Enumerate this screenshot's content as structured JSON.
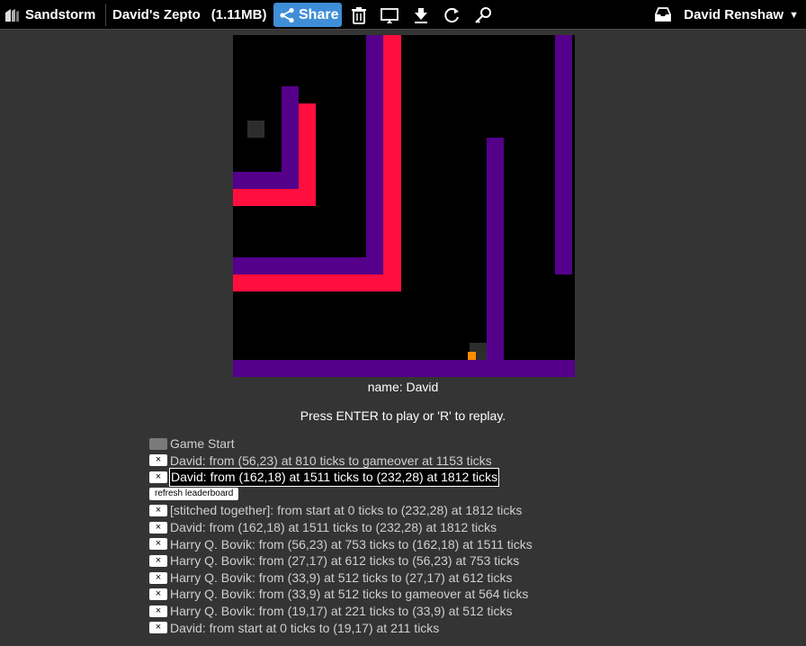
{
  "topbar": {
    "brand": "Sandstorm",
    "grain_title": "David's Zepto",
    "grain_size": "(1.11MB)",
    "share_label": "Share",
    "user_name": "David Renshaw",
    "icons": [
      "trash-icon",
      "monitor-icon",
      "download-icon",
      "restart-icon",
      "key-icon",
      "inbox-icon"
    ]
  },
  "colors": {
    "accent": "#3f8ed8",
    "player_purple": "#55008a",
    "player_red": "#ff0e3e",
    "food": "#ff8c00",
    "background": "#343434"
  },
  "game": {
    "name_label": "name: David",
    "prompt": "Press ENTER to play or 'R' to replay."
  },
  "log": {
    "game_start": "Game Start",
    "entry_1": "David: from (56,23) at 810 ticks to gameover at 1153 ticks",
    "entry_2": "David: from (162,18) at 1511 ticks to (232,28) at 1812 ticks",
    "refresh_label": "refresh leaderboard",
    "leaderboard": [
      "[stitched together]: from start at 0 ticks to (232,28) at 1812 ticks",
      "David: from (162,18) at 1511 ticks to (232,28) at 1812 ticks",
      "Harry Q. Bovik: from (56,23) at 753 ticks to (162,18) at 1511 ticks",
      "Harry Q. Bovik: from (27,17) at 612 ticks to (56,23) at 753 ticks",
      "Harry Q. Bovik: from (33,9) at 512 ticks to (27,17) at 612 ticks",
      "Harry Q. Bovik: from (33,9) at 512 ticks to gameover at 564 ticks",
      "Harry Q. Bovik: from (19,17) at 221 ticks to (33,9) at 512 ticks",
      "David: from start at 0 ticks to (19,17) at 211 ticks"
    ],
    "close_glyph": "×"
  }
}
